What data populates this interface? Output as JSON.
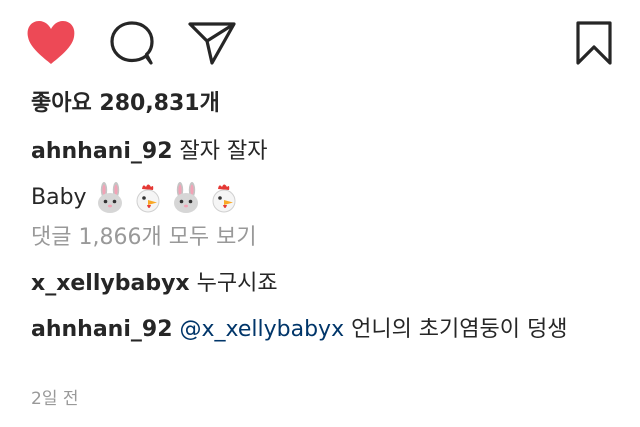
{
  "actions": {
    "like_icon": "heart-filled-icon",
    "comment_icon": "speech-bubble-icon",
    "share_icon": "paper-plane-icon",
    "save_icon": "bookmark-icon",
    "like_color": "#ed4956"
  },
  "likes": {
    "label": "좋아요",
    "count": "280,831개"
  },
  "caption": {
    "username": "ahnhani_92",
    "text": "잘자 잘자",
    "continuation": "Baby",
    "emojis": [
      "rabbit-face-icon",
      "chicken-icon",
      "rabbit-face-icon",
      "chicken-icon"
    ]
  },
  "view_comments": {
    "label": "댓글 1,866개 모두 보기"
  },
  "comments": [
    {
      "username": "x_xellybabyx",
      "text": "누구시죠"
    },
    {
      "username": "ahnhani_92",
      "mention": "@x_xellybabyx",
      "text": "언니의 초기염둥이 덩생"
    }
  ],
  "timestamp": "2일 전"
}
